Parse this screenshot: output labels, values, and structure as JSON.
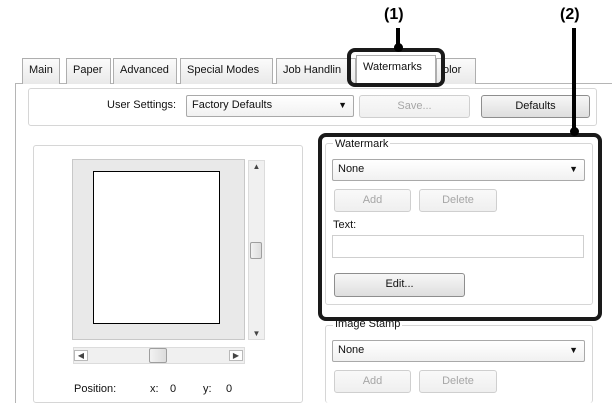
{
  "callouts": {
    "one": "(1)",
    "two": "(2)"
  },
  "tabs": [
    {
      "label": "Main"
    },
    {
      "label": "Paper"
    },
    {
      "label": "Advanced"
    },
    {
      "label": "Special Modes"
    },
    {
      "label": "Job Handlin"
    },
    {
      "label": "Watermarks"
    },
    {
      "label": "olor"
    }
  ],
  "user_settings": {
    "label": "User Settings:",
    "selected": "Factory Defaults",
    "save_label": "Save...",
    "defaults_label": "Defaults"
  },
  "preview": {
    "position_label": "Position:",
    "x_label": "x:",
    "x_value": "0",
    "y_label": "y:",
    "y_value": "0"
  },
  "watermark": {
    "group_label": "Watermark",
    "selected": "None",
    "add_label": "Add",
    "delete_label": "Delete",
    "text_label": "Text:",
    "text_value": "",
    "edit_label": "Edit..."
  },
  "image_stamp": {
    "group_label": "Image Stamp",
    "selected": "None",
    "add_label": "Add",
    "delete_label": "Delete"
  },
  "icons": {
    "dropdown": "▼",
    "up": "▲",
    "down": "▼",
    "left": "◀",
    "right": "▶"
  }
}
